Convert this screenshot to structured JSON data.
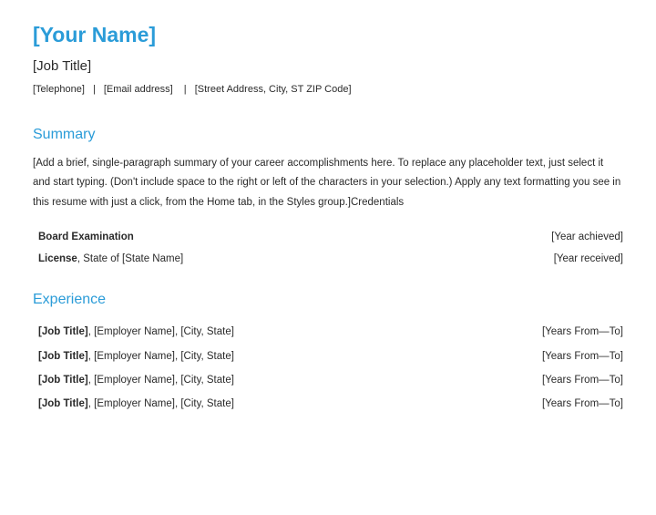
{
  "header": {
    "name": "[Your Name]",
    "job_title": "[Job Title]",
    "telephone": "[Telephone]",
    "email": "[Email address]",
    "address": "[Street Address, City, ST ZIP Code]"
  },
  "summary": {
    "heading": "Summary",
    "text": "[Add a brief, single-paragraph summary of your career accomplishments here. To replace any placeholder text, just select it and start typing. (Don't include space to the right or left of the characters in your selection.) Apply any text formatting you see in this resume with just a click, from the Home tab, in the Styles group.]Credentials"
  },
  "credentials": [
    {
      "label_bold": "Board Examination",
      "label_rest": "",
      "value": "[Year achieved]"
    },
    {
      "label_bold": "License",
      "label_rest": ", State of [State Name]",
      "value": "[Year received]"
    }
  ],
  "experience": {
    "heading": "Experience",
    "items": [
      {
        "title": "[Job Title]",
        "rest": ", [Employer Name], [City, State]",
        "years": "[Years From—To]"
      },
      {
        "title": "[Job Title]",
        "rest": ", [Employer Name], [City, State]",
        "years": "[Years From—To]"
      },
      {
        "title": "[Job Title]",
        "rest": ", [Employer Name], [City, State]",
        "years": "[Years From—To]"
      },
      {
        "title": "[Job Title]",
        "rest": ", [Employer Name], [City, State]",
        "years": "[Years From—To]"
      }
    ]
  }
}
